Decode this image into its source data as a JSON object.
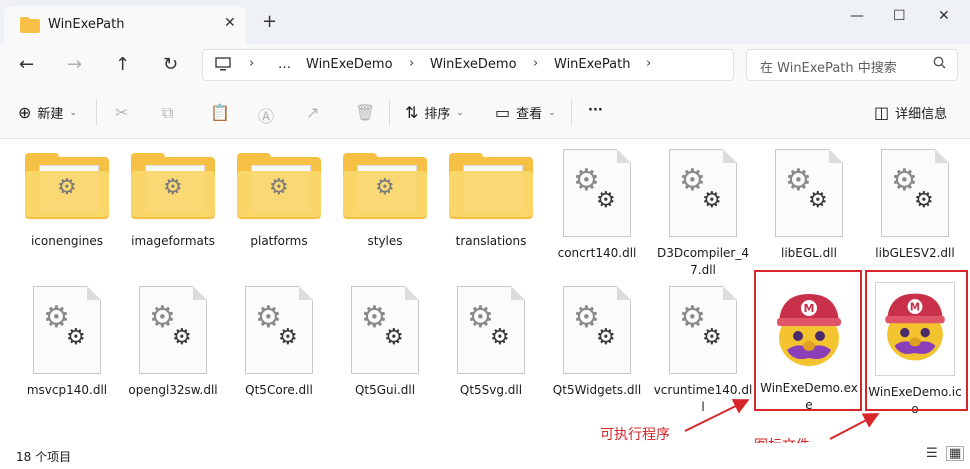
{
  "window": {
    "tab_title": "WinExePath",
    "new_tab": "+",
    "close_tab": "✕",
    "minimize": "—",
    "maximize": "☐",
    "close": "✕"
  },
  "nav": {
    "breadcrumb": [
      "…",
      "WinExeDemo",
      "WinExeDemo",
      "WinExePath"
    ],
    "search_placeholder": "在 WinExePath 中搜索"
  },
  "toolbar": {
    "new_label": "新建",
    "sort_label": "排序",
    "view_label": "查看",
    "more_label": "···",
    "details_label": "详细信息"
  },
  "files": [
    {
      "name": "iconengines",
      "type": "folder"
    },
    {
      "name": "imageformats",
      "type": "folder"
    },
    {
      "name": "platforms",
      "type": "folder"
    },
    {
      "name": "styles",
      "type": "folder"
    },
    {
      "name": "translations",
      "type": "folder"
    },
    {
      "name": "concrt140.dll",
      "type": "dll"
    },
    {
      "name": "D3Dcompiler_47.dll",
      "type": "dll"
    },
    {
      "name": "libEGL.dll",
      "type": "dll"
    },
    {
      "name": "libGLESV2.dll",
      "type": "dll"
    },
    {
      "name": "msvcp140.dll",
      "type": "dll"
    },
    {
      "name": "opengl32sw.dll",
      "type": "dll"
    },
    {
      "name": "Qt5Core.dll",
      "type": "dll"
    },
    {
      "name": "Qt5Gui.dll",
      "type": "dll"
    },
    {
      "name": "Qt5Svg.dll",
      "type": "dll"
    },
    {
      "name": "Qt5Widgets.dll",
      "type": "dll"
    },
    {
      "name": "vcruntime140.dll",
      "type": "dll"
    },
    {
      "name": "WinExeDemo.exe",
      "type": "exe"
    },
    {
      "name": "WinExeDemo.ico",
      "type": "ico"
    }
  ],
  "annotations": {
    "exe_note": "可执行程序",
    "ico_note": "图标文件"
  },
  "status": {
    "count_text": "18 个项目"
  },
  "colors": {
    "annotation_red": "#d6262a",
    "folder_yellow": "#f5c043"
  }
}
